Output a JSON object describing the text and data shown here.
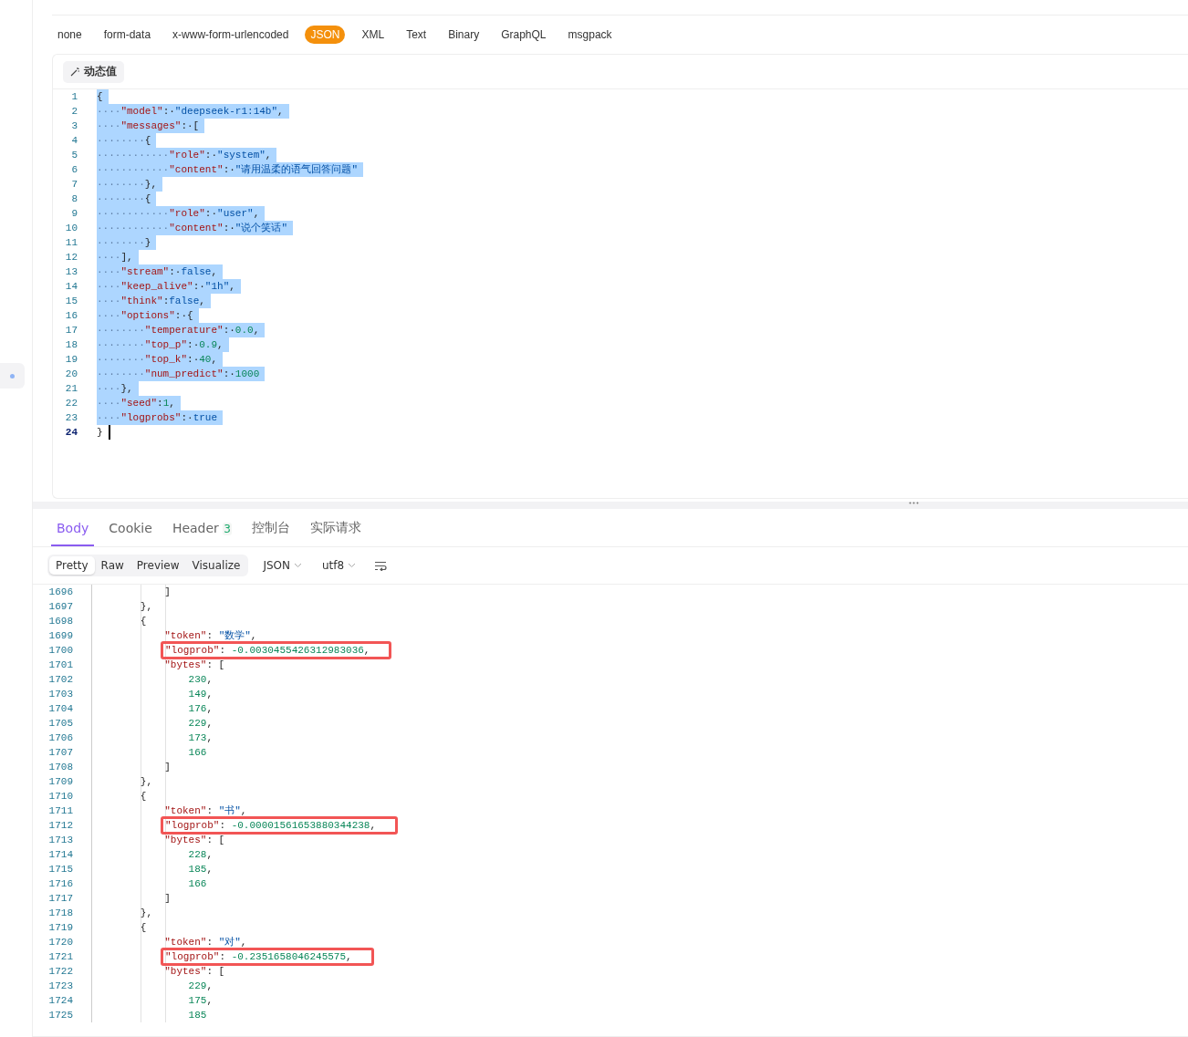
{
  "body_types": [
    {
      "label": "none",
      "selected": false
    },
    {
      "label": "form-data",
      "selected": false
    },
    {
      "label": "x-www-form-urlencoded",
      "selected": false
    },
    {
      "label": "JSON",
      "selected": true
    },
    {
      "label": "XML",
      "selected": false
    },
    {
      "label": "Text",
      "selected": false
    },
    {
      "label": "Binary",
      "selected": false
    },
    {
      "label": "GraphQL",
      "selected": false
    },
    {
      "label": "msgpack",
      "selected": false
    }
  ],
  "dynamic_value_button": "动态值",
  "request_lines": [
    {
      "number": "1",
      "selected": true,
      "tokens": [
        {
          "kind": "punct",
          "text": "{"
        }
      ]
    },
    {
      "number": "2",
      "selected": true,
      "tokens": [
        {
          "kind": "indent",
          "text": "····"
        },
        {
          "kind": "key",
          "text": "\"model\""
        },
        {
          "kind": "punct",
          "text": ":·"
        },
        {
          "kind": "string",
          "text": "\"deepseek-r1:14b\""
        },
        {
          "kind": "punct",
          "text": ","
        }
      ]
    },
    {
      "number": "3",
      "selected": true,
      "tokens": [
        {
          "kind": "indent",
          "text": "····"
        },
        {
          "kind": "key",
          "text": "\"messages\""
        },
        {
          "kind": "punct",
          "text": ":·["
        }
      ]
    },
    {
      "number": "4",
      "selected": true,
      "tokens": [
        {
          "kind": "indent",
          "text": "········"
        },
        {
          "kind": "punct",
          "text": "{"
        }
      ]
    },
    {
      "number": "5",
      "selected": true,
      "tokens": [
        {
          "kind": "indent",
          "text": "············"
        },
        {
          "kind": "key",
          "text": "\"role\""
        },
        {
          "kind": "punct",
          "text": ":·"
        },
        {
          "kind": "string",
          "text": "\"system\""
        },
        {
          "kind": "punct",
          "text": ","
        }
      ]
    },
    {
      "number": "6",
      "selected": true,
      "tokens": [
        {
          "kind": "indent",
          "text": "············"
        },
        {
          "kind": "key",
          "text": "\"content\""
        },
        {
          "kind": "punct",
          "text": ":·"
        },
        {
          "kind": "string",
          "text": "\"请用温柔的语气回答问题\""
        }
      ]
    },
    {
      "number": "7",
      "selected": true,
      "tokens": [
        {
          "kind": "indent",
          "text": "········"
        },
        {
          "kind": "punct",
          "text": "},"
        }
      ]
    },
    {
      "number": "8",
      "selected": true,
      "tokens": [
        {
          "kind": "indent",
          "text": "········"
        },
        {
          "kind": "punct",
          "text": "{"
        }
      ]
    },
    {
      "number": "9",
      "selected": true,
      "tokens": [
        {
          "kind": "indent",
          "text": "············"
        },
        {
          "kind": "key",
          "text": "\"role\""
        },
        {
          "kind": "punct",
          "text": ":·"
        },
        {
          "kind": "string",
          "text": "\"user\""
        },
        {
          "kind": "punct",
          "text": ","
        }
      ]
    },
    {
      "number": "10",
      "selected": true,
      "tokens": [
        {
          "kind": "indent",
          "text": "············"
        },
        {
          "kind": "key",
          "text": "\"content\""
        },
        {
          "kind": "punct",
          "text": ":·"
        },
        {
          "kind": "string",
          "text": "\"说个笑话\""
        }
      ]
    },
    {
      "number": "11",
      "selected": true,
      "tokens": [
        {
          "kind": "indent",
          "text": "········"
        },
        {
          "kind": "punct",
          "text": "}"
        }
      ]
    },
    {
      "number": "12",
      "selected": true,
      "tokens": [
        {
          "kind": "indent",
          "text": "····"
        },
        {
          "kind": "punct",
          "text": "],"
        }
      ]
    },
    {
      "number": "13",
      "selected": true,
      "tokens": [
        {
          "kind": "indent",
          "text": "····"
        },
        {
          "kind": "key",
          "text": "\"stream\""
        },
        {
          "kind": "punct",
          "text": ":·"
        },
        {
          "kind": "literal",
          "text": "false"
        },
        {
          "kind": "punct",
          "text": ","
        }
      ]
    },
    {
      "number": "14",
      "selected": true,
      "tokens": [
        {
          "kind": "indent",
          "text": "····"
        },
        {
          "kind": "key",
          "text": "\"keep_alive\""
        },
        {
          "kind": "punct",
          "text": ":·"
        },
        {
          "kind": "string",
          "text": "\"1h\""
        },
        {
          "kind": "punct",
          "text": ","
        }
      ]
    },
    {
      "number": "15",
      "selected": true,
      "tokens": [
        {
          "kind": "indent",
          "text": "····"
        },
        {
          "kind": "key",
          "text": "\"think\""
        },
        {
          "kind": "punct",
          "text": ":"
        },
        {
          "kind": "literal",
          "text": "false"
        },
        {
          "kind": "punct",
          "text": ","
        }
      ]
    },
    {
      "number": "16",
      "selected": true,
      "tokens": [
        {
          "kind": "indent",
          "text": "····"
        },
        {
          "kind": "key",
          "text": "\"options\""
        },
        {
          "kind": "punct",
          "text": ":·{"
        }
      ]
    },
    {
      "number": "17",
      "selected": true,
      "tokens": [
        {
          "kind": "indent",
          "text": "········"
        },
        {
          "kind": "key",
          "text": "\"temperature\""
        },
        {
          "kind": "punct",
          "text": ":·"
        },
        {
          "kind": "number",
          "text": "0.0"
        },
        {
          "kind": "punct",
          "text": ","
        }
      ]
    },
    {
      "number": "18",
      "selected": true,
      "tokens": [
        {
          "kind": "indent",
          "text": "········"
        },
        {
          "kind": "key",
          "text": "\"top_p\""
        },
        {
          "kind": "punct",
          "text": ":·"
        },
        {
          "kind": "number",
          "text": "0.9"
        },
        {
          "kind": "punct",
          "text": ","
        }
      ]
    },
    {
      "number": "19",
      "selected": true,
      "tokens": [
        {
          "kind": "indent",
          "text": "········"
        },
        {
          "kind": "key",
          "text": "\"top_k\""
        },
        {
          "kind": "punct",
          "text": ":·"
        },
        {
          "kind": "number",
          "text": "40"
        },
        {
          "kind": "punct",
          "text": ","
        }
      ]
    },
    {
      "number": "20",
      "selected": true,
      "tokens": [
        {
          "kind": "indent",
          "text": "········"
        },
        {
          "kind": "key",
          "text": "\"num_predict\""
        },
        {
          "kind": "punct",
          "text": ":·"
        },
        {
          "kind": "number",
          "text": "1000"
        }
      ]
    },
    {
      "number": "21",
      "selected": true,
      "tokens": [
        {
          "kind": "indent",
          "text": "····"
        },
        {
          "kind": "punct",
          "text": "},"
        }
      ]
    },
    {
      "number": "22",
      "selected": true,
      "tokens": [
        {
          "kind": "indent",
          "text": "····"
        },
        {
          "kind": "key",
          "text": "\"seed\""
        },
        {
          "kind": "punct",
          "text": ":"
        },
        {
          "kind": "number",
          "text": "1"
        },
        {
          "kind": "punct",
          "text": ","
        }
      ]
    },
    {
      "number": "23",
      "selected": true,
      "tokens": [
        {
          "kind": "indent",
          "text": "····"
        },
        {
          "kind": "key",
          "text": "\"logprobs\""
        },
        {
          "kind": "punct",
          "text": ":·"
        },
        {
          "kind": "literal",
          "text": "true"
        }
      ]
    },
    {
      "number": "24",
      "selected": false,
      "cursor": true,
      "tokens": [
        {
          "kind": "punct",
          "text": "}"
        }
      ]
    }
  ],
  "response_tabs": [
    {
      "label": "Body",
      "selected": true
    },
    {
      "label": "Cookie",
      "selected": false
    },
    {
      "label": "Header",
      "badge": "3",
      "selected": false
    },
    {
      "label": "控制台",
      "selected": false
    },
    {
      "label": "实际请求",
      "selected": false
    }
  ],
  "view_modes": [
    {
      "label": "Pretty",
      "selected": true
    },
    {
      "label": "Raw",
      "selected": false
    },
    {
      "label": "Preview",
      "selected": false
    },
    {
      "label": "Visualize",
      "selected": false
    }
  ],
  "format_dropdown": "JSON",
  "encoding_dropdown": "utf8",
  "response_lines": [
    {
      "number": "1696",
      "highlighted": false,
      "tokens": [
        {
          "kind": "punct",
          "text": "            ]"
        }
      ]
    },
    {
      "number": "1697",
      "highlighted": false,
      "tokens": [
        {
          "kind": "punct",
          "text": "        },"
        }
      ]
    },
    {
      "number": "1698",
      "highlighted": false,
      "tokens": [
        {
          "kind": "punct",
          "text": "        {"
        }
      ]
    },
    {
      "number": "1699",
      "highlighted": false,
      "tokens": [
        {
          "kind": "key",
          "text": "            \"token\""
        },
        {
          "kind": "punct",
          "text": ": "
        },
        {
          "kind": "string",
          "text": "\"数学\""
        },
        {
          "kind": "punct",
          "text": ","
        }
      ]
    },
    {
      "number": "1700",
      "highlighted": true,
      "tokens": [
        {
          "kind": "key",
          "text": "\"logprob\""
        },
        {
          "kind": "punct",
          "text": ": "
        },
        {
          "kind": "number",
          "text": "-0.0030455426312983036"
        },
        {
          "kind": "punct",
          "text": ","
        }
      ]
    },
    {
      "number": "1701",
      "highlighted": false,
      "tokens": [
        {
          "kind": "key",
          "text": "            \"bytes\""
        },
        {
          "kind": "punct",
          "text": ": ["
        }
      ]
    },
    {
      "number": "1702",
      "highlighted": false,
      "tokens": [
        {
          "kind": "number",
          "text": "                230"
        },
        {
          "kind": "punct",
          "text": ","
        }
      ]
    },
    {
      "number": "1703",
      "highlighted": false,
      "tokens": [
        {
          "kind": "number",
          "text": "                149"
        },
        {
          "kind": "punct",
          "text": ","
        }
      ]
    },
    {
      "number": "1704",
      "highlighted": false,
      "tokens": [
        {
          "kind": "number",
          "text": "                176"
        },
        {
          "kind": "punct",
          "text": ","
        }
      ]
    },
    {
      "number": "1705",
      "highlighted": false,
      "tokens": [
        {
          "kind": "number",
          "text": "                229"
        },
        {
          "kind": "punct",
          "text": ","
        }
      ]
    },
    {
      "number": "1706",
      "highlighted": false,
      "tokens": [
        {
          "kind": "number",
          "text": "                173"
        },
        {
          "kind": "punct",
          "text": ","
        }
      ]
    },
    {
      "number": "1707",
      "highlighted": false,
      "tokens": [
        {
          "kind": "number",
          "text": "                166"
        }
      ]
    },
    {
      "number": "1708",
      "highlighted": false,
      "tokens": [
        {
          "kind": "punct",
          "text": "            ]"
        }
      ]
    },
    {
      "number": "1709",
      "highlighted": false,
      "tokens": [
        {
          "kind": "punct",
          "text": "        },"
        }
      ]
    },
    {
      "number": "1710",
      "highlighted": false,
      "tokens": [
        {
          "kind": "punct",
          "text": "        {"
        }
      ]
    },
    {
      "number": "1711",
      "highlighted": false,
      "tokens": [
        {
          "kind": "key",
          "text": "            \"token\""
        },
        {
          "kind": "punct",
          "text": ": "
        },
        {
          "kind": "string",
          "text": "\"书\""
        },
        {
          "kind": "punct",
          "text": ","
        }
      ]
    },
    {
      "number": "1712",
      "highlighted": true,
      "tokens": [
        {
          "kind": "key",
          "text": "\"logprob\""
        },
        {
          "kind": "punct",
          "text": ": "
        },
        {
          "kind": "number",
          "text": "-0.00001561653880344238"
        },
        {
          "kind": "punct",
          "text": ","
        }
      ]
    },
    {
      "number": "1713",
      "highlighted": false,
      "tokens": [
        {
          "kind": "key",
          "text": "            \"bytes\""
        },
        {
          "kind": "punct",
          "text": ": ["
        }
      ]
    },
    {
      "number": "1714",
      "highlighted": false,
      "tokens": [
        {
          "kind": "number",
          "text": "                228"
        },
        {
          "kind": "punct",
          "text": ","
        }
      ]
    },
    {
      "number": "1715",
      "highlighted": false,
      "tokens": [
        {
          "kind": "number",
          "text": "                185"
        },
        {
          "kind": "punct",
          "text": ","
        }
      ]
    },
    {
      "number": "1716",
      "highlighted": false,
      "tokens": [
        {
          "kind": "number",
          "text": "                166"
        }
      ]
    },
    {
      "number": "1717",
      "highlighted": false,
      "tokens": [
        {
          "kind": "punct",
          "text": "            ]"
        }
      ]
    },
    {
      "number": "1718",
      "highlighted": false,
      "tokens": [
        {
          "kind": "punct",
          "text": "        },"
        }
      ]
    },
    {
      "number": "1719",
      "highlighted": false,
      "tokens": [
        {
          "kind": "punct",
          "text": "        {"
        }
      ]
    },
    {
      "number": "1720",
      "highlighted": false,
      "tokens": [
        {
          "kind": "key",
          "text": "            \"token\""
        },
        {
          "kind": "punct",
          "text": ": "
        },
        {
          "kind": "string",
          "text": "\"对\""
        },
        {
          "kind": "punct",
          "text": ","
        }
      ]
    },
    {
      "number": "1721",
      "highlighted": true,
      "tokens": [
        {
          "kind": "key",
          "text": "\"logprob\""
        },
        {
          "kind": "punct",
          "text": ": "
        },
        {
          "kind": "number",
          "text": "-0.2351658046245575"
        },
        {
          "kind": "punct",
          "text": ","
        }
      ]
    },
    {
      "number": "1722",
      "highlighted": false,
      "tokens": [
        {
          "kind": "key",
          "text": "            \"bytes\""
        },
        {
          "kind": "punct",
          "text": ": ["
        }
      ]
    },
    {
      "number": "1723",
      "highlighted": false,
      "tokens": [
        {
          "kind": "number",
          "text": "                229"
        },
        {
          "kind": "punct",
          "text": ","
        }
      ]
    },
    {
      "number": "1724",
      "highlighted": false,
      "tokens": [
        {
          "kind": "number",
          "text": "                175"
        },
        {
          "kind": "punct",
          "text": ","
        }
      ]
    },
    {
      "number": "1725",
      "highlighted": false,
      "tokens": [
        {
          "kind": "number",
          "text": "                185"
        }
      ]
    }
  ]
}
